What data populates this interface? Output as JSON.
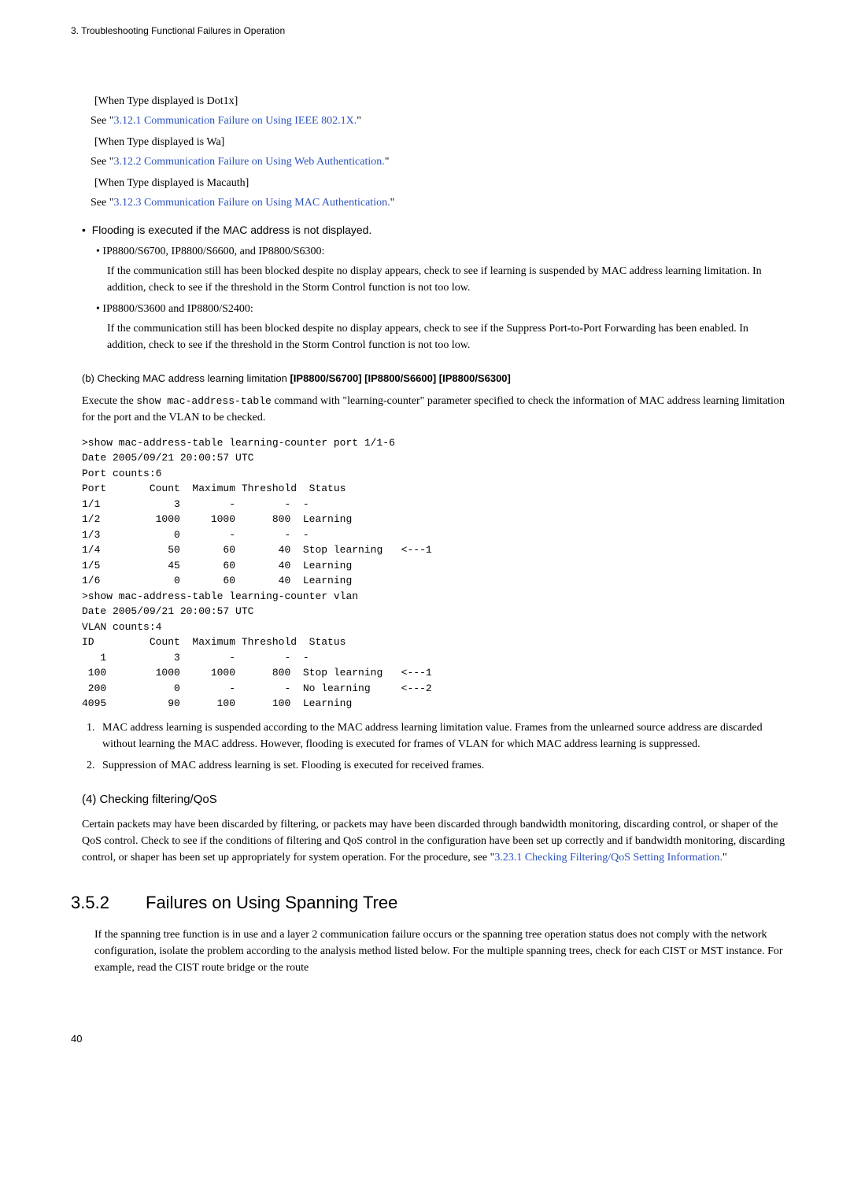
{
  "chapterHead": "3.   Troubleshooting Functional Failures in Operation",
  "types": {
    "dot1x": {
      "label": "[When Type displayed is Dot1x]",
      "see": "See \"",
      "link": "3.12.1 Communication Failure on Using IEEE 802.1X.",
      "after": "\""
    },
    "wa": {
      "label": "[When Type displayed is Wa]",
      "see": "See \"",
      "link": "3.12.2 Communication Failure on Using Web Authentication.",
      "after": "\""
    },
    "macauth": {
      "label": "[When Type displayed is Macauth]",
      "see": "See \"",
      "link": "3.12.3 Communication Failure on Using MAC Authentication.",
      "after": "\""
    }
  },
  "flooding": {
    "heading": "Flooding is executed if the MAC address is not displayed.",
    "items": [
      {
        "label": "IP8800/S6700, IP8800/S6600, and IP8800/S6300:",
        "body": "If the communication still has been blocked despite no display appears, check to see if learning is suspended by MAC address learning limitation. In addition, check to see if the threshold in the Storm Control function is not too low."
      },
      {
        "label": "IP8800/S3600 and IP8800/S2400:",
        "body": "If the communication still has been blocked despite no display appears, check to see if the Suppress Port-to-Port Forwarding has been enabled. In addition, check to see if the threshold in the Storm Control function is not too low."
      }
    ]
  },
  "sectionB": {
    "prefix": "(b)   Checking MAC address learning limitation ",
    "bold": "[IP8800/S6700] [IP8800/S6600] [IP8800/S6300]",
    "introPre": "Execute the ",
    "introCode": "show mac-address-table",
    "introPost": " command with \"learning-counter\" parameter specified to check the information of MAC address learning limitation for the port and the VLAN to be checked."
  },
  "console": ">show mac-address-table learning-counter port 1/1-6\nDate 2005/09/21 20:00:57 UTC\nPort counts:6\nPort       Count  Maximum Threshold  Status\n1/1            3        -        -  -\n1/2         1000     1000      800  Learning\n1/3            0        -        -  -\n1/4           50       60       40  Stop learning   <---1\n1/5           45       60       40  Learning\n1/6            0       60       40  Learning\n>show mac-address-table learning-counter vlan\nDate 2005/09/21 20:00:57 UTC\nVLAN counts:4\nID         Count  Maximum Threshold  Status\n   1           3        -        -  -\n 100        1000     1000      800  Stop learning   <---1\n 200           0        -        -  No learning     <---2\n4095          90      100      100  Learning",
  "numList": [
    "MAC address learning is suspended according to the MAC address learning limitation value. Frames from the unlearned source address are discarded without learning the MAC address. However, flooding is executed for frames of VLAN for which MAC address learning is suppressed.",
    "Suppression of MAC address learning is set. Flooding is executed for received frames."
  ],
  "sec4": {
    "head": "(4)   Checking filtering/QoS",
    "bodyPre": "Certain packets may have been discarded by filtering, or packets may have been discarded through bandwidth monitoring, discarding control, or shaper of the QoS control. Check to see if the conditions of filtering and QoS control in the configuration have been set up correctly and if bandwidth monitoring, discarding control, or shaper has been set up appropriately for system operation. For the procedure, see \"",
    "link": "3.23.1 Checking Filtering/QoS Setting Information.",
    "after": "\""
  },
  "sec352": {
    "num": "3.5.2",
    "title": "Failures on Using Spanning Tree",
    "body": "If the spanning tree function is in use and a layer 2 communication failure occurs or the spanning tree operation status does not comply with the network configuration, isolate the problem according to the analysis method listed below. For the multiple spanning trees, check for each CIST or MST instance. For example, read the CIST route bridge or the route"
  },
  "pageNum": "40"
}
